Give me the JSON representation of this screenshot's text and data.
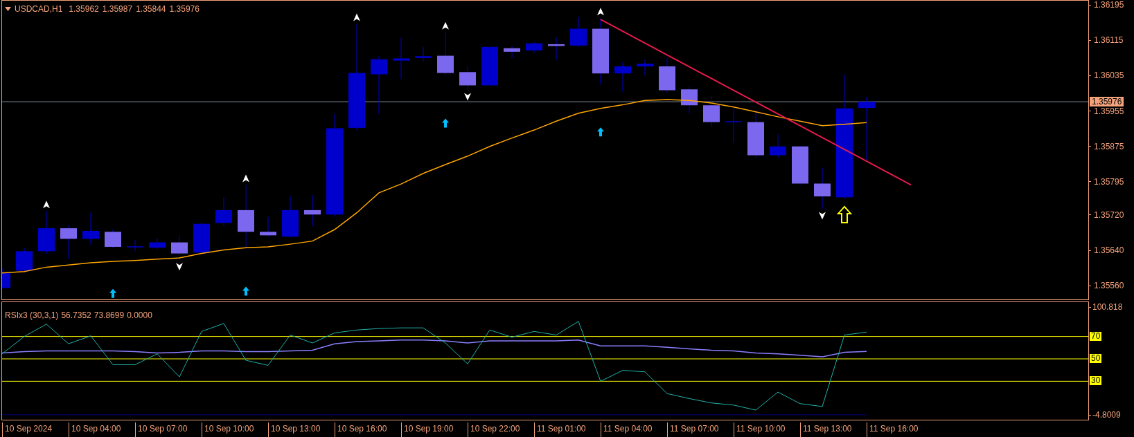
{
  "main_chart": {
    "symbol": "USDCAD,H1",
    "quotes": [
      "1.35962",
      "1.35987",
      "1.35844",
      "1.35976"
    ],
    "price_axis": [
      "1.36195",
      "1.36115",
      "1.36035",
      "1.35955",
      "1.35875",
      "1.35795",
      "1.35720",
      "1.35640",
      "1.35560"
    ],
    "current_price": "1.35976"
  },
  "indicator": {
    "title": "RSIx3 (30,3,1)",
    "readings": [
      "56.7352",
      "73.8699",
      "0.0000"
    ],
    "scale": [
      "100.818",
      "-4.8009"
    ],
    "levels": [
      "70",
      "50",
      "30"
    ]
  },
  "time_axis": [
    "10 Sep 2024",
    "10 Sep 04:00",
    "10 Sep 07:00",
    "10 Sep 10:00",
    "10 Sep 13:00",
    "10 Sep 16:00",
    "10 Sep 19:00",
    "10 Sep 22:00",
    "11 Sep 01:00",
    "11 Sep 04:00",
    "11 Sep 07:00",
    "11 Sep 10:00",
    "11 Sep 13:00",
    "11 Sep 16:00"
  ]
}
